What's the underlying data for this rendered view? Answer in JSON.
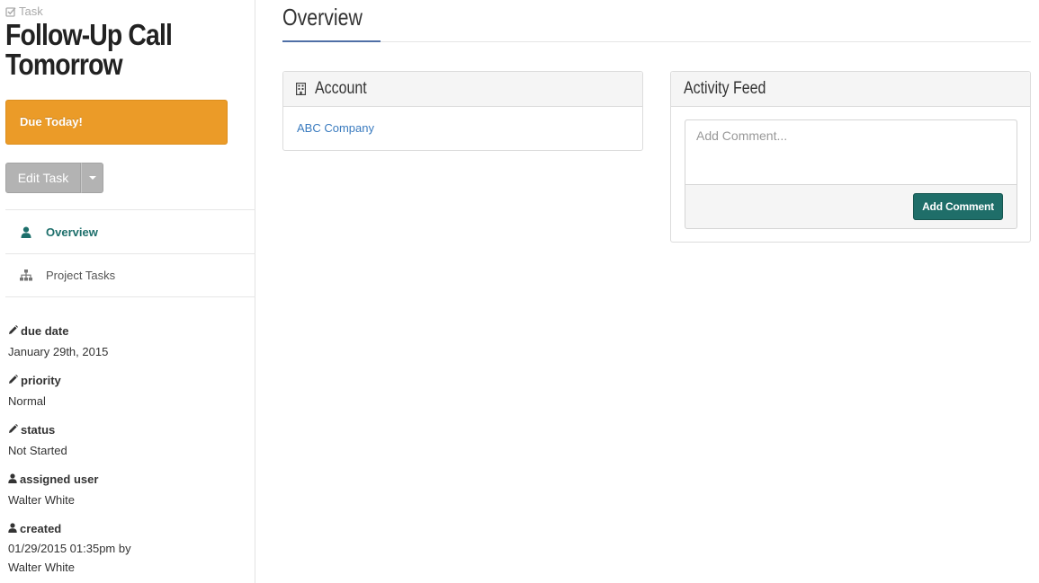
{
  "sidebar": {
    "record_type": "Task",
    "title": "Follow-Up Call Tomorrow",
    "due_banner": "Due Today!",
    "edit_button": "Edit Task",
    "nav": [
      {
        "label": "Overview",
        "icon": "user-icon",
        "active": true
      },
      {
        "label": "Project Tasks",
        "icon": "sitemap-icon",
        "active": false
      }
    ],
    "fields": [
      {
        "label": "due date",
        "icon": "pencil-icon",
        "value": "January 29th, 2015"
      },
      {
        "label": "priority",
        "icon": "pencil-icon",
        "value": "Normal"
      },
      {
        "label": "status",
        "icon": "pencil-icon",
        "value": "Not Started"
      },
      {
        "label": "assigned user",
        "icon": "user-icon",
        "value": "Walter White"
      },
      {
        "label": "created",
        "icon": "user-icon",
        "value_line1": "01/29/2015 01:35pm by",
        "value_line2": "Walter White"
      }
    ]
  },
  "main": {
    "title": "Overview",
    "account_panel": {
      "title": "Account",
      "icon": "building-icon",
      "link": "ABC Company"
    },
    "feed_panel": {
      "title": "Activity Feed",
      "placeholder": "Add Comment...",
      "button": "Add Comment"
    }
  },
  "colors": {
    "due_banner": "#eb9b28",
    "accent_teal": "#1f6e69",
    "link_blue": "#3a7bbf",
    "title_accent": "#4f6fa6"
  }
}
